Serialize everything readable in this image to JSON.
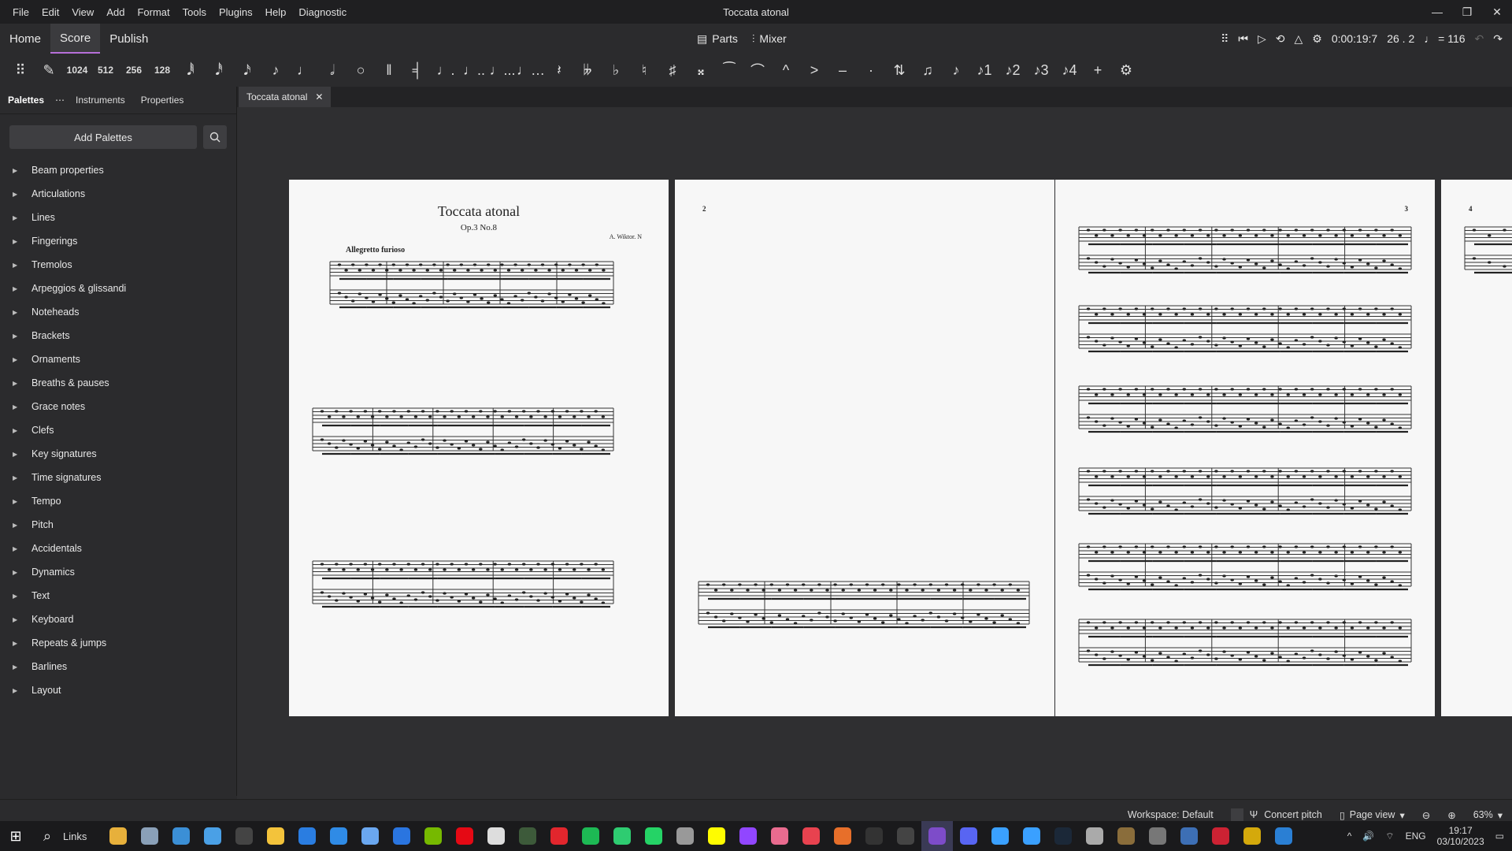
{
  "app": {
    "window_title": "Toccata atonal"
  },
  "menu": [
    "File",
    "Edit",
    "View",
    "Add",
    "Format",
    "Tools",
    "Plugins",
    "Help",
    "Diagnostic"
  ],
  "main_tabs": {
    "home": "Home",
    "score": "Score",
    "publish": "Publish"
  },
  "top_center": {
    "parts": "Parts",
    "mixer": "Mixer"
  },
  "playback": {
    "time": "0:00:19:7",
    "position": "26 . 2",
    "tempo": "♩ = 116"
  },
  "toolbar_durations": [
    "1024",
    "512",
    "256",
    "128"
  ],
  "palette_tabs": {
    "palettes": "Palettes",
    "instruments": "Instruments",
    "properties": "Properties"
  },
  "add_palettes": "Add Palettes",
  "palettes": [
    "Beam properties",
    "Articulations",
    "Lines",
    "Fingerings",
    "Tremolos",
    "Arpeggios & glissandi",
    "Noteheads",
    "Brackets",
    "Ornaments",
    "Breaths & pauses",
    "Grace notes",
    "Clefs",
    "Key signatures",
    "Time signatures",
    "Tempo",
    "Pitch",
    "Accidentals",
    "Dynamics",
    "Text",
    "Keyboard",
    "Repeats & jumps",
    "Barlines",
    "Layout"
  ],
  "doc_tab": "Toccata atonal",
  "score": {
    "title": "Toccata atonal",
    "subtitle": "Op.3 No.8",
    "composer": "A. Wiktor. N",
    "tempo_marking": "Allegretto furioso",
    "page_numbers": [
      "2",
      "3",
      "4"
    ]
  },
  "status": {
    "workspace": "Workspace: Default",
    "concert": "Concert pitch",
    "view": "Page view",
    "zoom": "63%"
  },
  "taskbar": {
    "search": "Links",
    "lang": "ENG",
    "time": "19:17",
    "date": "03/10/2023"
  }
}
